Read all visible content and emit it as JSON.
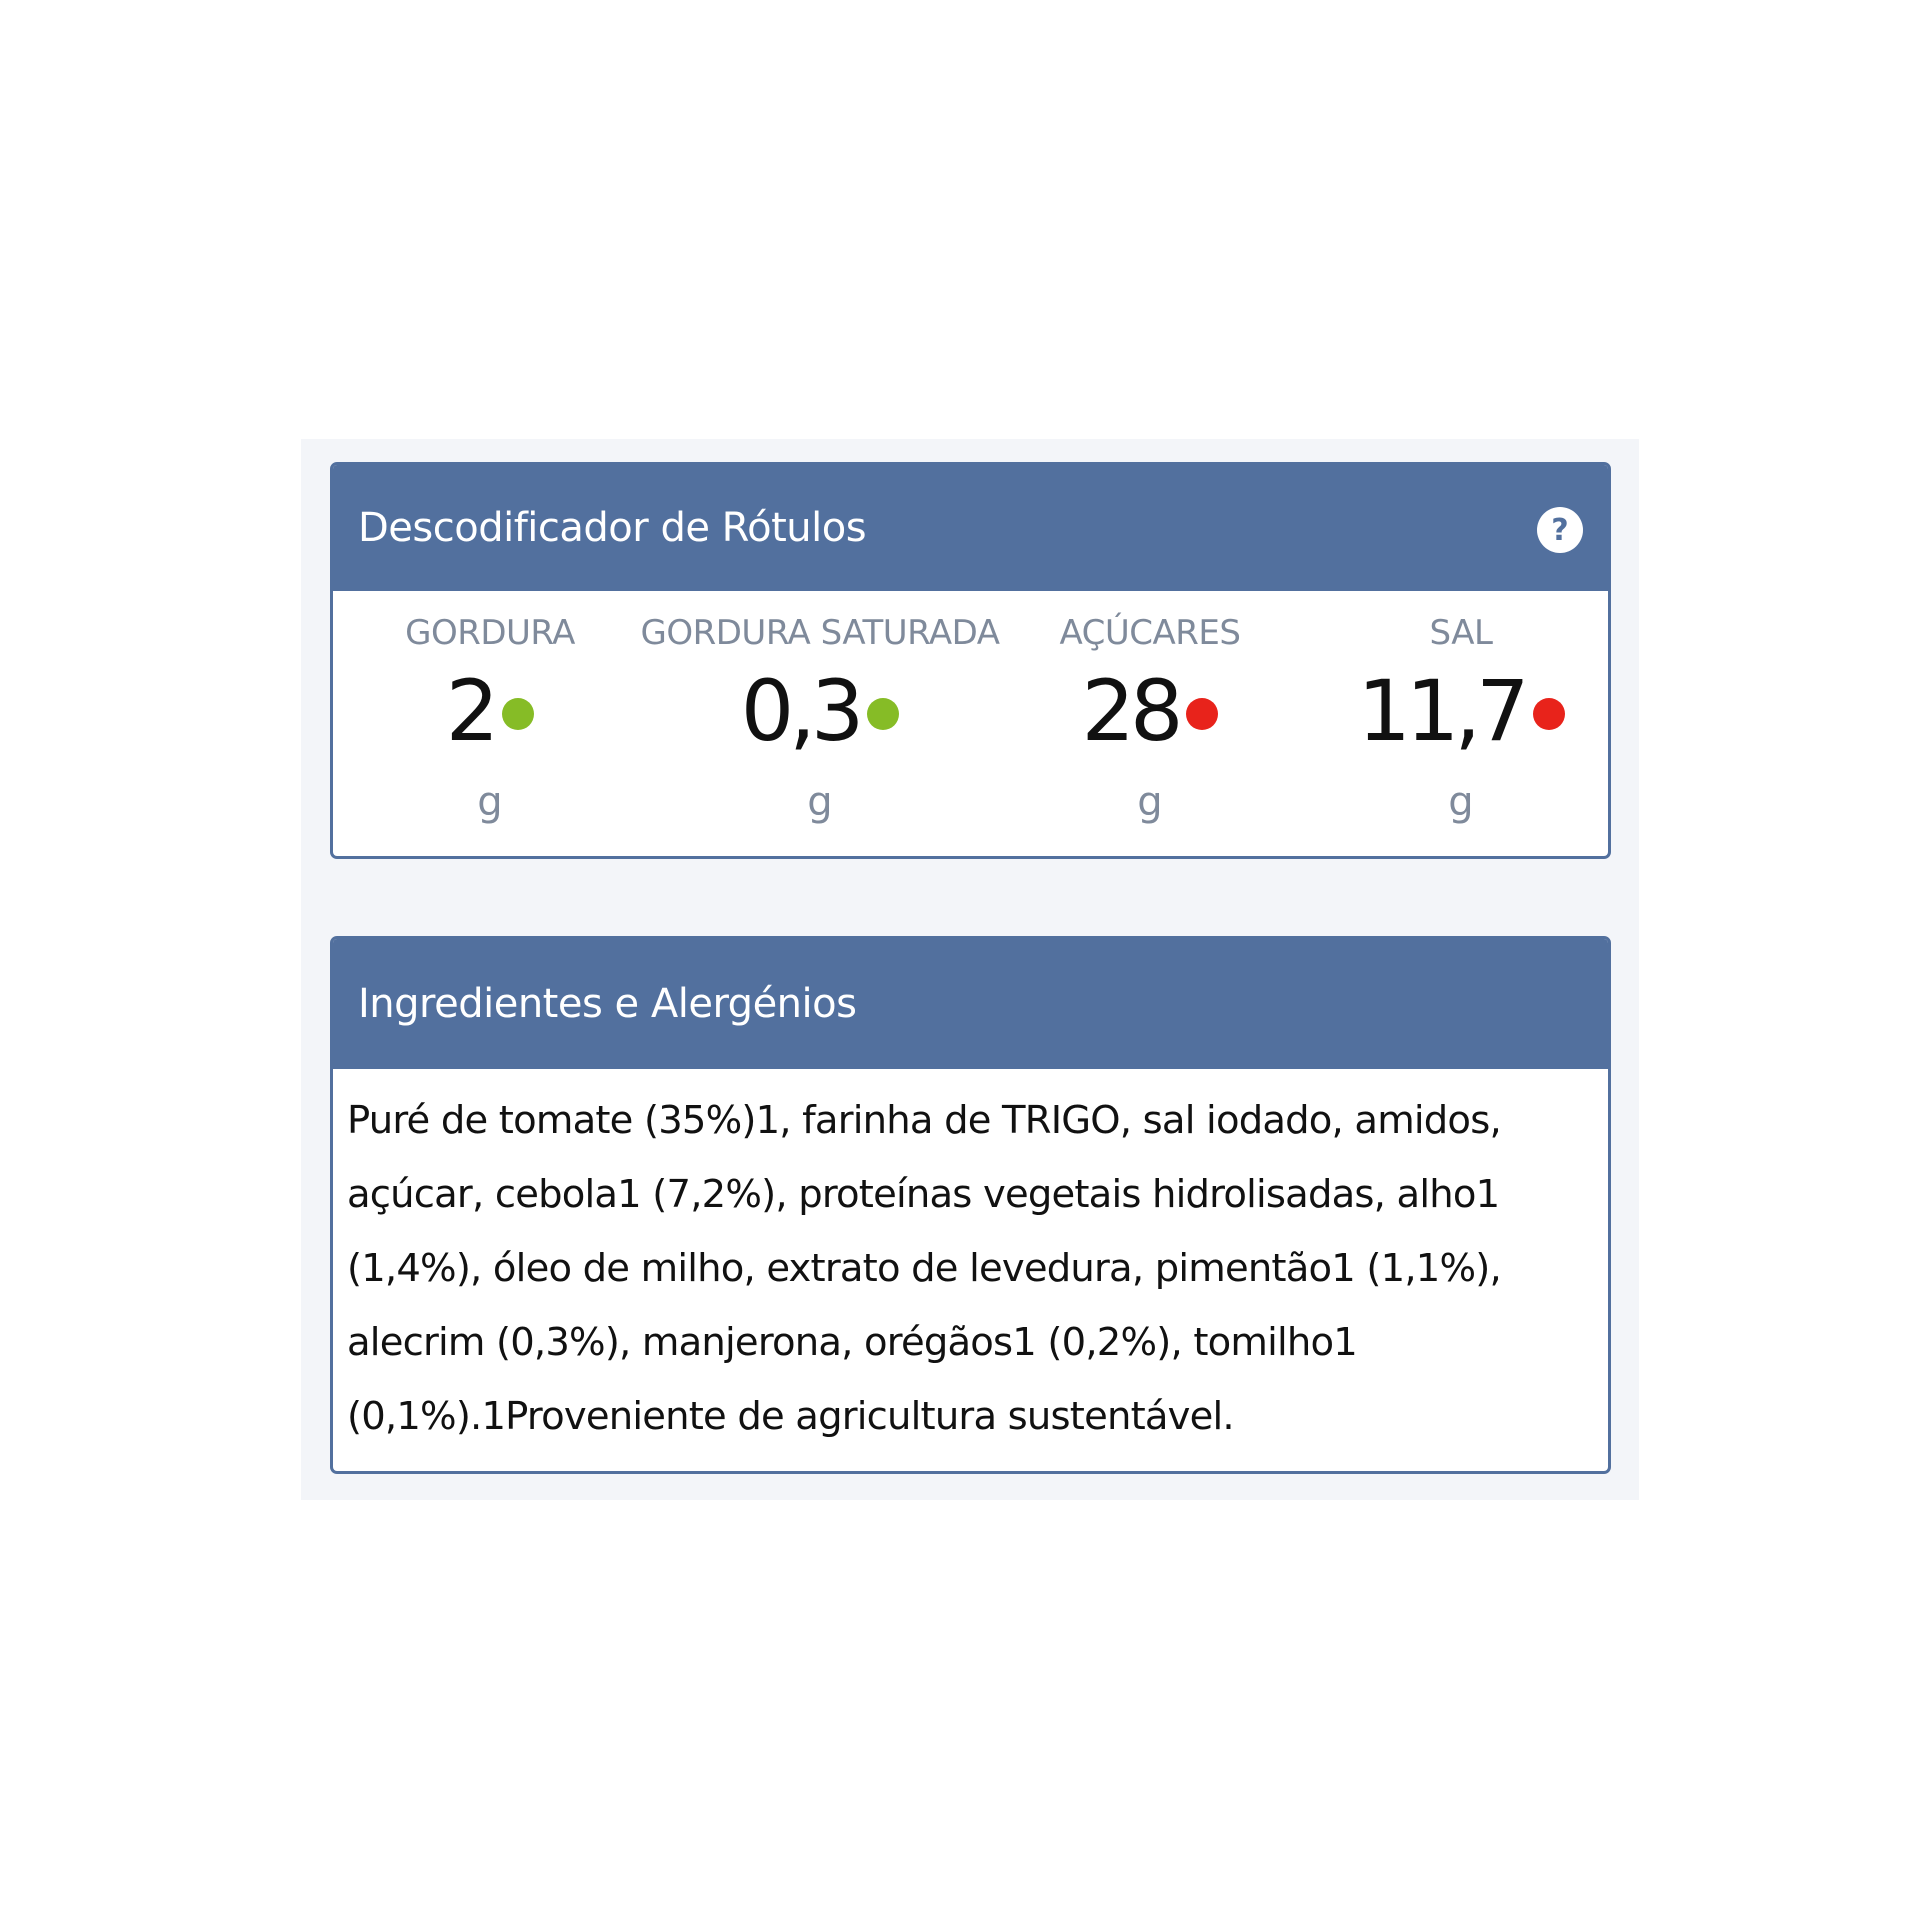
{
  "decoder": {
    "title": "Descodificador de Rótulos",
    "help_icon": "question-circle-icon",
    "nutrients": [
      {
        "label": "GORDURA",
        "value": "2",
        "unit": "g",
        "status": "green"
      },
      {
        "label": "GORDURA SATURADA",
        "value": "0,3",
        "unit": "g",
        "status": "green"
      },
      {
        "label": "AÇÚCARES",
        "value": "28",
        "unit": "g",
        "status": "red"
      },
      {
        "label": "SAL",
        "value": "11,7",
        "unit": "g",
        "status": "red"
      }
    ],
    "colors": {
      "header": "#52709e",
      "green": "#86bc26",
      "red": "#e8231b"
    }
  },
  "ingredients": {
    "title": "Ingredientes e Alergénios",
    "text": "Puré de tomate (35%)1, farinha de TRIGO, sal iodado, amidos, açúcar, cebola1 (7,2%), proteínas vegetais hidrolisadas, alho1 (1,4%), óleo de milho, extrato de levedura, pimentão1 (1,1%), alecrim (0,3%), manjerona, orégãos1 (0,2%), tomilho1 (0,1%).1Proveniente de agricultura sustentável."
  }
}
